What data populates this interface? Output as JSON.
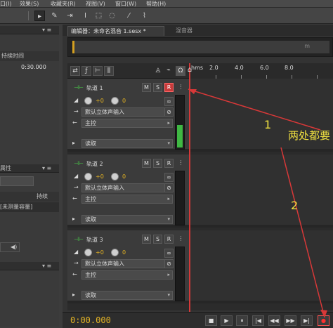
{
  "menu": {
    "items": [
      {
        "label": "口(I)"
      },
      {
        "label": "效果(S)"
      },
      {
        "label": "收藏夹(R)"
      },
      {
        "label": "视图(V)"
      },
      {
        "label": "窗口(W)"
      },
      {
        "label": "帮助(H)"
      }
    ]
  },
  "left_panel": {
    "header_control": "▾ ≡",
    "column_duration": "持续时间",
    "row_duration": "0:30.000",
    "properties_label": "属性",
    "properties_col": "持续",
    "properties_row": "[未测量容量]"
  },
  "tabs": {
    "editor": "编辑器：未命名混音 1.sesx *",
    "mixer": "混音器"
  },
  "overview": {
    "label": "m"
  },
  "ruler": {
    "labels": [
      "hms",
      "2.0",
      "4.0",
      "6.0",
      "8.0"
    ]
  },
  "tracks": [
    {
      "name": "轨道 1",
      "buttons": {
        "mute": "M",
        "solo": "S",
        "record": "R",
        "more": "⋮"
      },
      "volume": "+0",
      "pan": "0",
      "input": "默认立体声输入",
      "output": "主控",
      "automation": "读取",
      "meter_level": 0.3
    },
    {
      "name": "轨道 2",
      "buttons": {
        "mute": "M",
        "solo": "S",
        "record": "R",
        "more": "⋮"
      },
      "volume": "+0",
      "pan": "0",
      "input": "默认立体声输入",
      "output": "主控",
      "automation": "读取",
      "meter_level": 0
    },
    {
      "name": "轨道 3",
      "buttons": {
        "mute": "M",
        "solo": "S",
        "record": "R",
        "more": "⋮"
      },
      "volume": "+0",
      "pan": "0",
      "input": "默认立体声输入",
      "output": "主控",
      "automation": "读取",
      "meter_level": 0
    }
  ],
  "transport": {
    "time": "0:00.000",
    "buttons": [
      "■",
      "▶",
      "⏸",
      "|◀",
      "◀◀",
      "▶▶",
      "▶|",
      "●"
    ]
  },
  "annotations": {
    "text": "两处都要",
    "mark1": "1",
    "mark2": "2",
    "arrow_color": "#d83838",
    "text_color": "#f0e040"
  },
  "colors": {
    "accent": "#e4b425",
    "record": "#c83a3a",
    "meter": "#3fb843",
    "playhead": "#d43838"
  }
}
